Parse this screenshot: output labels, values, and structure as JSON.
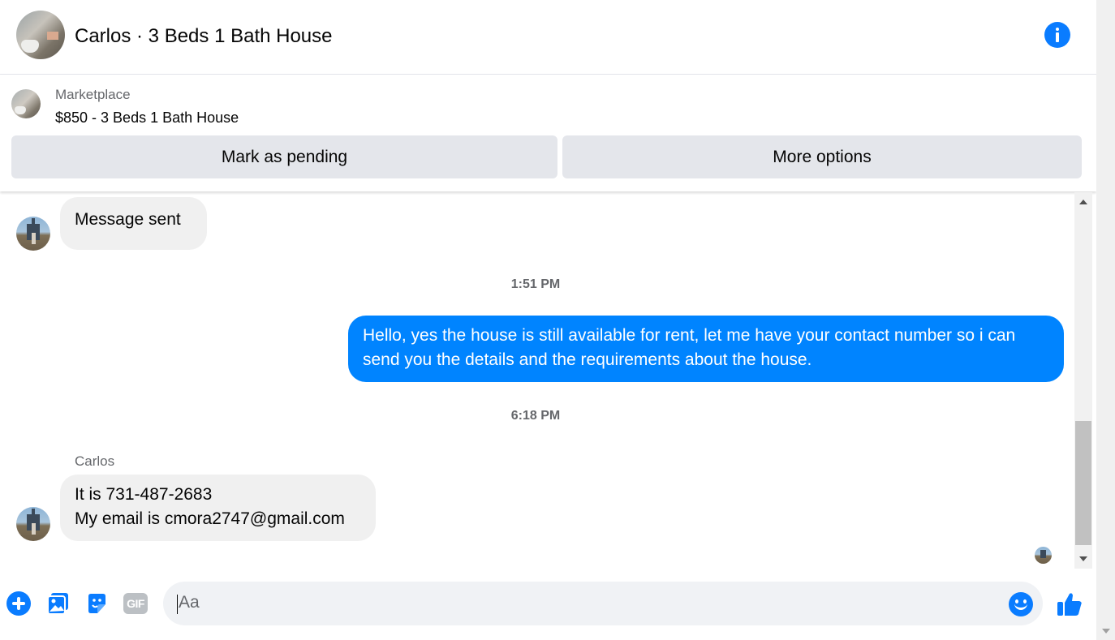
{
  "header": {
    "title": "Carlos · 3 Beds 1 Bath House"
  },
  "marketplace": {
    "label": "Marketplace",
    "item": "$850 - 3 Beds 1 Bath House",
    "mark_pending_label": "Mark as pending",
    "more_options_label": "More options"
  },
  "messages": {
    "first_in": "Message sent",
    "time_1": "1:51 PM",
    "out_1": "Hello, yes the house is still available for rent, let me have your contact number so i can send you the details and the requirements about the house.",
    "time_2": "6:18 PM",
    "sender_name": "Carlos",
    "reply_line1": "It is 731-487-2683",
    "reply_line2": "My email is cmora2747@gmail.com"
  },
  "composer": {
    "placeholder": "Aa",
    "gif_label": "GIF"
  },
  "colors": {
    "accent": "#0a7cff",
    "outgoing_bubble": "#0084ff",
    "incoming_bubble": "#f0f0f0"
  }
}
